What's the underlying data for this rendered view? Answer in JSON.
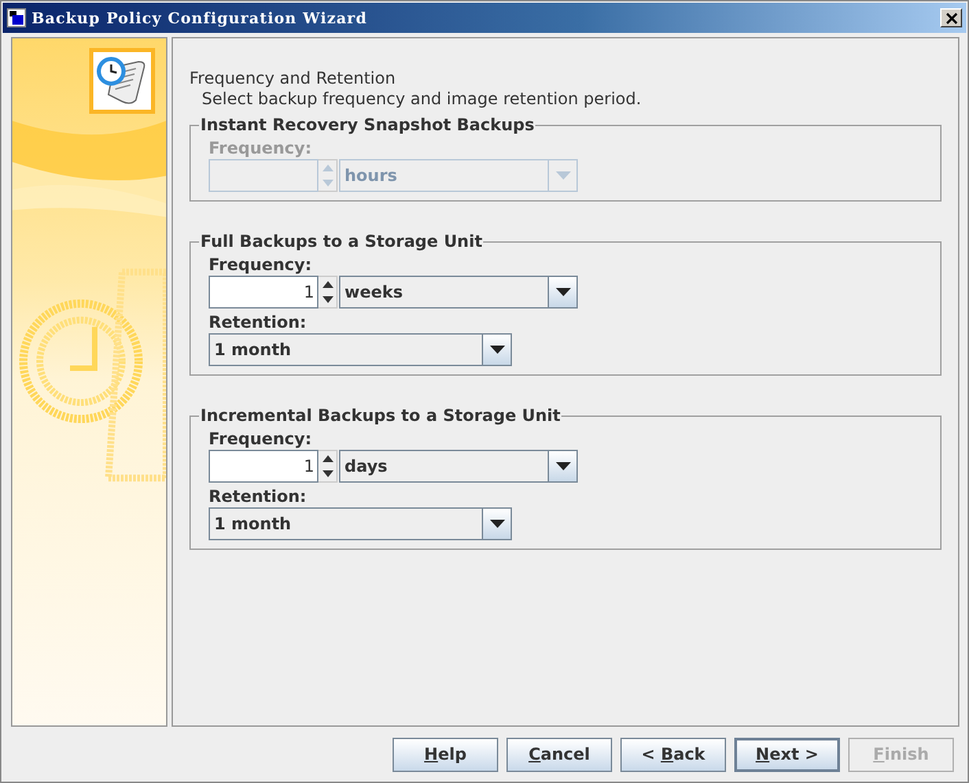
{
  "window": {
    "title": "Backup Policy Configuration Wizard"
  },
  "page": {
    "title": "Frequency and Retention",
    "subtitle": "Select backup frequency and image retention period."
  },
  "groups": [
    {
      "title": "Instant Recovery Snapshot Backups",
      "disabled": true,
      "fields": [
        {
          "kind": "spinner_combo",
          "label": "Frequency:",
          "unit": "hours"
        }
      ]
    },
    {
      "title": "Full Backups to a Storage Unit",
      "disabled": false,
      "fields": [
        {
          "kind": "spinner_combo",
          "label": "Frequency:",
          "value": "1",
          "unit": "weeks"
        },
        {
          "kind": "combo",
          "label": "Retention:",
          "value": "1 month"
        }
      ]
    },
    {
      "title": "Incremental Backups to a Storage Unit",
      "disabled": false,
      "fields": [
        {
          "kind": "spinner_combo",
          "label": "Frequency:",
          "value": "1",
          "unit": "days"
        },
        {
          "kind": "combo",
          "label": "Retention:",
          "value": "1 month"
        }
      ]
    }
  ],
  "buttons": [
    {
      "mnemonic": "H",
      "rest": "elp",
      "default": false,
      "disabled": false
    },
    {
      "mnemonic": "C",
      "rest": "ancel",
      "default": false,
      "disabled": false
    },
    {
      "before": "< ",
      "mnemonic": "B",
      "rest": "ack",
      "default": false,
      "disabled": false
    },
    {
      "mnemonic": "N",
      "rest": "ext >",
      "default": true,
      "disabled": false
    },
    {
      "mnemonic": "F",
      "rest": "inish",
      "default": false,
      "disabled": true
    }
  ]
}
